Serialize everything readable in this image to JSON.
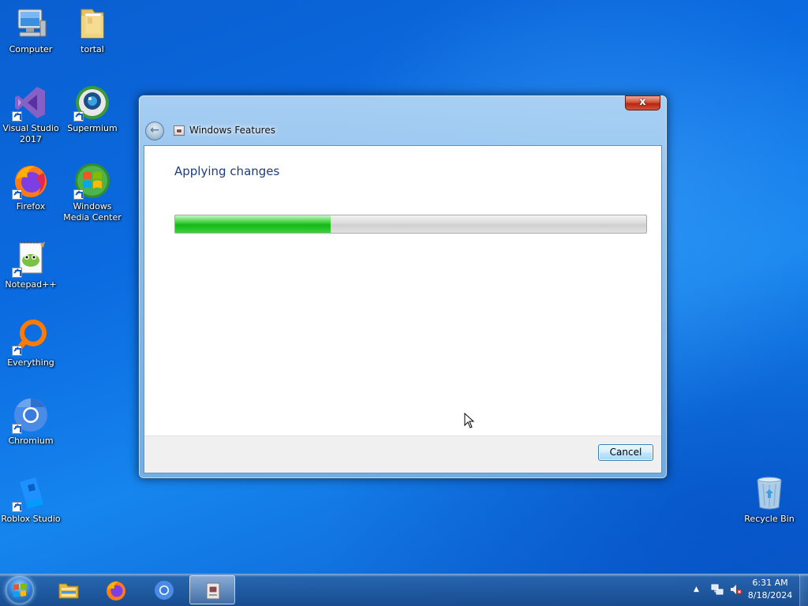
{
  "desktop": {
    "icons": [
      {
        "label": "Computer",
        "icon": "computer-icon"
      },
      {
        "label": "tortal",
        "icon": "folder-icon"
      },
      {
        "label": "Visual Studio 2017",
        "icon": "visual-studio-icon"
      },
      {
        "label": "Supermium",
        "icon": "supermium-icon"
      },
      {
        "label": "Firefox",
        "icon": "firefox-icon"
      },
      {
        "label": "Windows Media Center",
        "icon": "media-center-icon"
      },
      {
        "label": "Notepad++",
        "icon": "notepadpp-icon"
      },
      {
        "label": "Everything",
        "icon": "everything-icon"
      },
      {
        "label": "Chromium",
        "icon": "chromium-icon"
      },
      {
        "label": "Roblox Studio",
        "icon": "roblox-studio-icon"
      },
      {
        "label": "Recycle Bin",
        "icon": "recycle-bin-icon"
      }
    ]
  },
  "dialog": {
    "title": "Windows Features",
    "close_label": "x",
    "heading": "Applying changes",
    "progress": 0.33,
    "cancel_label": "Cancel"
  },
  "taskbar": {
    "pinned": [
      "explorer-icon",
      "firefox-icon",
      "chromium-icon",
      "windows-features-icon"
    ],
    "active_index": 3,
    "clock": {
      "time": "6:31 AM",
      "date": "8/18/2024"
    },
    "tray": [
      "show-hidden-icons",
      "network-icon",
      "volume-muted-icon"
    ]
  },
  "colors": {
    "progress_fill": "#16b816",
    "heading_text": "#1c3e7a",
    "desktop_blue": "#0b6be0"
  }
}
